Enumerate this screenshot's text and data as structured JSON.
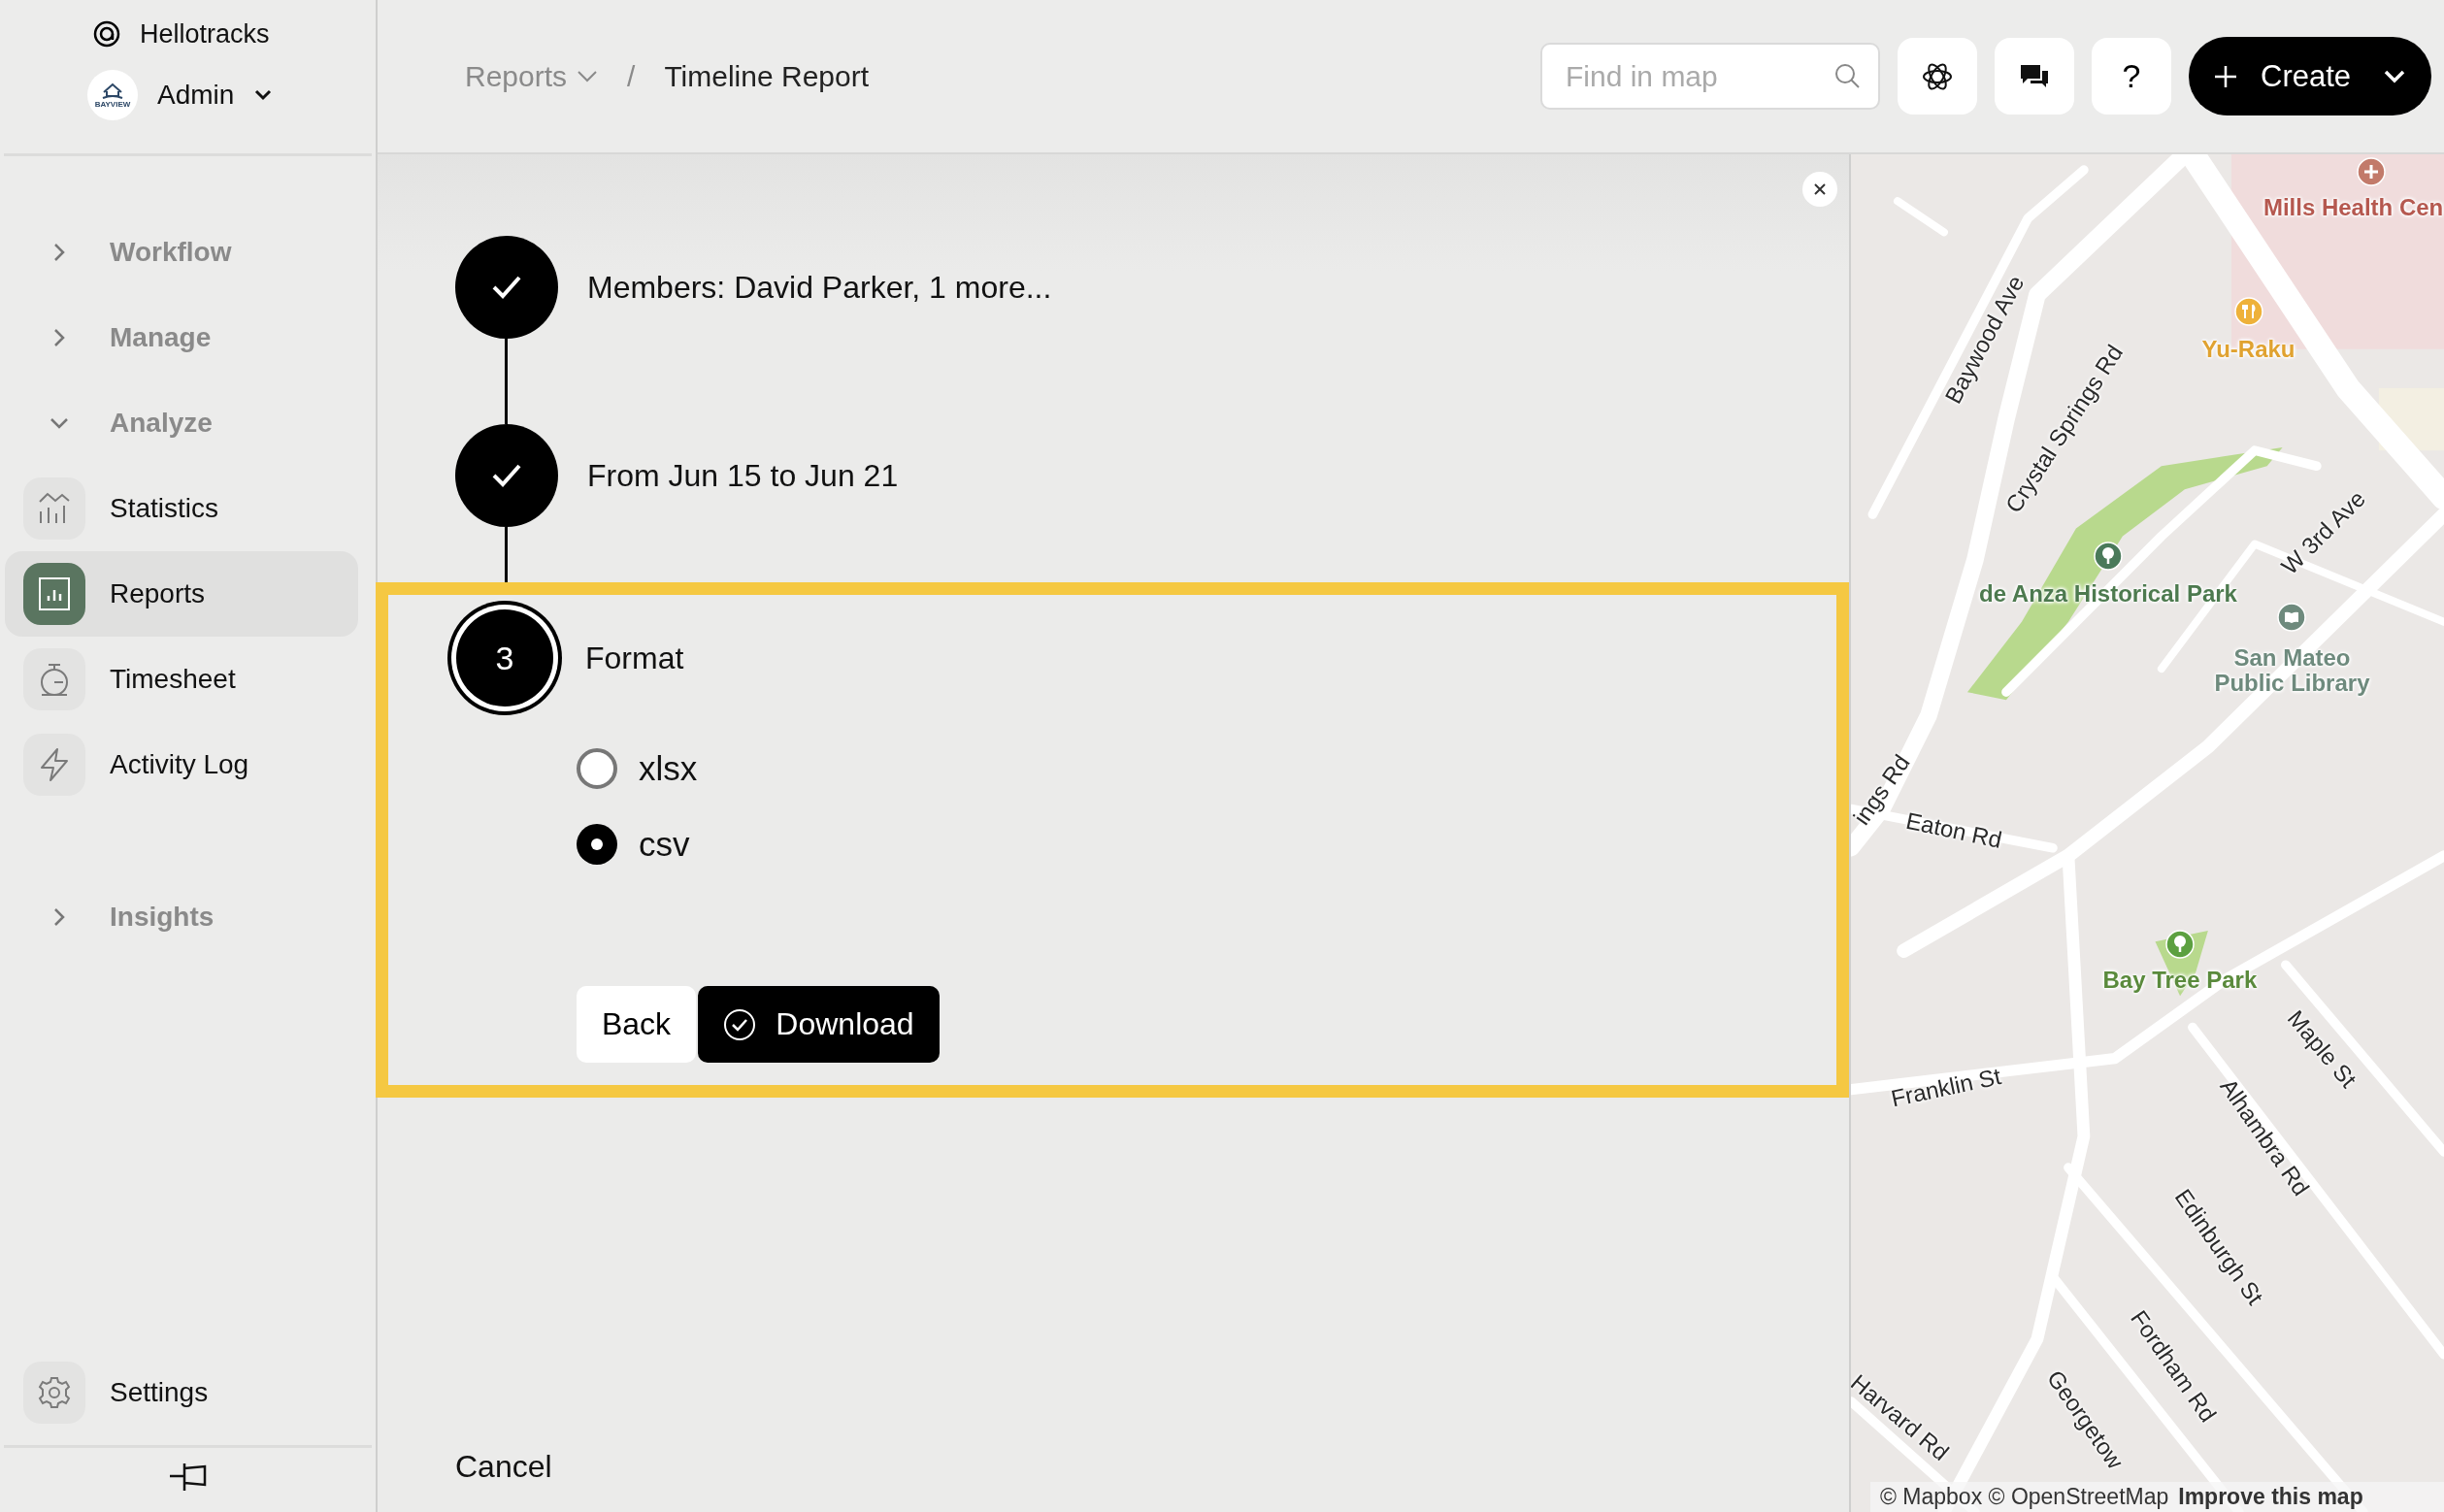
{
  "sidebar": {
    "brand": "Hellotracks",
    "account": {
      "name": "Admin",
      "logo_text": "BAYVIEW"
    },
    "nav": [
      {
        "kind": "section",
        "label": "Workflow",
        "expanded": false
      },
      {
        "kind": "section",
        "label": "Manage",
        "expanded": false
      },
      {
        "kind": "section",
        "label": "Analyze",
        "expanded": true
      },
      {
        "kind": "item",
        "label": "Statistics",
        "selected": false
      },
      {
        "kind": "item",
        "label": "Reports",
        "selected": true
      },
      {
        "kind": "item",
        "label": "Timesheet",
        "selected": false
      },
      {
        "kind": "item",
        "label": "Activity Log",
        "selected": false
      },
      {
        "kind": "section",
        "label": "Insights",
        "expanded": false
      }
    ],
    "settings": {
      "label": "Settings",
      "selected": false
    }
  },
  "topbar": {
    "breadcrumb": {
      "parent": "Reports",
      "separator": "/",
      "current": "Timeline Report"
    },
    "search": {
      "placeholder": "Find in map"
    },
    "help": "?",
    "create": "Create"
  },
  "steps": [
    {
      "kind": "done",
      "label": "Members: David Parker, 1 more..."
    },
    {
      "kind": "done",
      "label": "From Jun 15 to Jun 21"
    },
    {
      "kind": "current",
      "number": "3",
      "label": "Format",
      "highlighted": true,
      "options": [
        {
          "label": "xlsx",
          "selected": false
        },
        {
          "label": "csv",
          "selected": true
        }
      ],
      "back": "Back",
      "download": "Download"
    }
  ],
  "cancel": "Cancel",
  "map": {
    "labels": [
      {
        "kind": "place",
        "text": "Mills Health Cen",
        "color": "#b5584f"
      },
      {
        "kind": "place",
        "text": "Yu-Raku",
        "color": "#e0a230"
      },
      {
        "kind": "street",
        "text": "Baywood Ave"
      },
      {
        "kind": "street",
        "text": "Crystal Springs Rd"
      },
      {
        "kind": "place",
        "text": "de Anza Historical Park",
        "color": "#4d7a4f"
      },
      {
        "kind": "street",
        "text": "W 3rd Ave"
      },
      {
        "kind": "place",
        "text": "San Mateo Public Library",
        "color": "#6e8a7d"
      },
      {
        "kind": "street",
        "text": "ings Rd"
      },
      {
        "kind": "street",
        "text": "Eaton Rd"
      },
      {
        "kind": "place",
        "text": "Bay Tree Park",
        "color": "#5a8a3c"
      },
      {
        "kind": "street",
        "text": "Maple St"
      },
      {
        "kind": "street",
        "text": "Franklin St"
      },
      {
        "kind": "street",
        "text": "Alhambra Rd"
      },
      {
        "kind": "street",
        "text": "Edinburgh St"
      },
      {
        "kind": "street",
        "text": "Fordham Rd"
      },
      {
        "kind": "street",
        "text": "Harvard Rd"
      },
      {
        "kind": "street",
        "text": "Georgetow"
      }
    ],
    "attribution": "© Mapbox © OpenStreetMap",
    "improve": "Improve this map"
  }
}
